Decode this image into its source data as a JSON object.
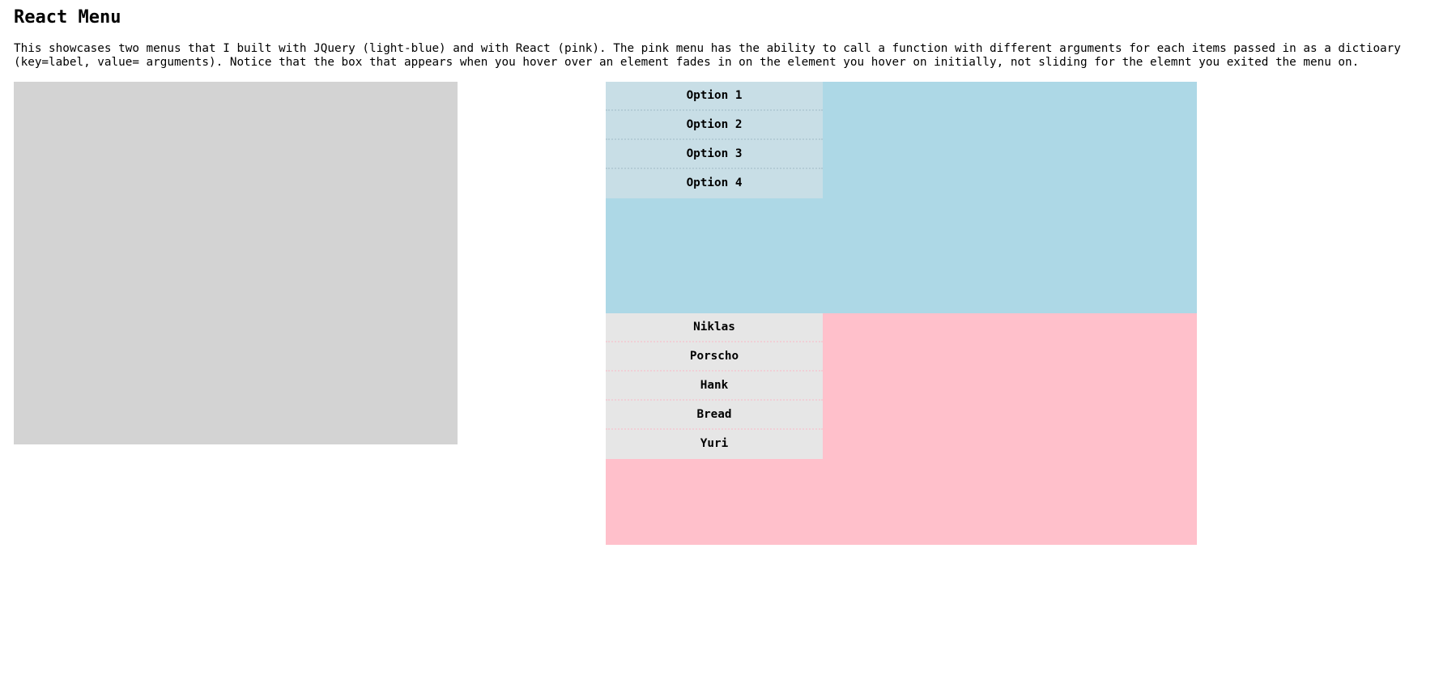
{
  "page": {
    "title": "React Menu",
    "description": "This showcases two menus that I built with JQuery (light-blue) and with React (pink). The pink menu has the ability to call a function with different arguments for each items passed in as a dictioary (key=label, value= arguments). Notice that the box that appears when you hover over an element fades in on the element you hover on initially, not sliding for the elemnt you exited the menu on."
  },
  "colors": {
    "display_box": "#d3d3d3",
    "jquery_menu": "#add8e6",
    "react_menu": "#ffc0cb"
  },
  "jquery_menu": {
    "items": [
      {
        "label": "Option 1"
      },
      {
        "label": "Option 2"
      },
      {
        "label": "Option 3"
      },
      {
        "label": "Option 4"
      }
    ]
  },
  "react_menu": {
    "items": [
      {
        "label": "Niklas"
      },
      {
        "label": "Porscho"
      },
      {
        "label": "Hank"
      },
      {
        "label": "Bread"
      },
      {
        "label": "Yuri"
      }
    ]
  }
}
